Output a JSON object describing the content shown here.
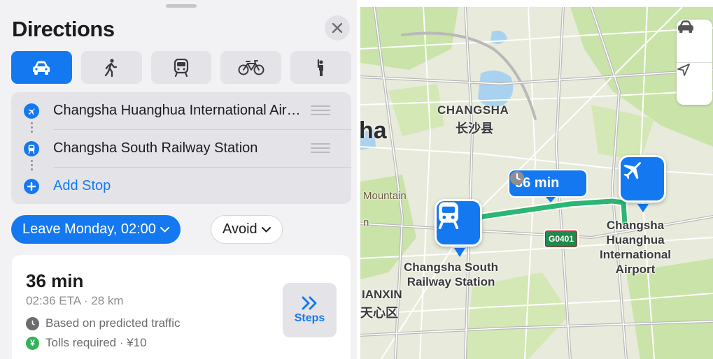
{
  "panel": {
    "title": "Directions",
    "close_icon": "close-icon",
    "transport_modes": [
      {
        "id": "drive",
        "icon": "car-icon",
        "active": true
      },
      {
        "id": "walk",
        "icon": "walking-person-icon",
        "active": false
      },
      {
        "id": "transit",
        "icon": "train-icon",
        "active": false
      },
      {
        "id": "cycle",
        "icon": "bicycle-icon",
        "active": false
      },
      {
        "id": "ride",
        "icon": "hailing-person-icon",
        "active": false
      }
    ],
    "stops": [
      {
        "label": "Changsha Huanghua International Airport",
        "icon": "airplane-icon"
      },
      {
        "label": "Changsha South Railway Station",
        "icon": "train-icon"
      }
    ],
    "add_stop_label": "Add Stop",
    "leave_label": "Leave Monday, 02:00",
    "avoid_label": "Avoid",
    "route": {
      "duration": "36 min",
      "eta_distance": "02:36 ETA · 28 km",
      "traffic_note": "Based on predicted traffic",
      "tolls_note": "Tolls required · ¥10",
      "steps_label": "Steps"
    }
  },
  "map": {
    "callout_duration": "36 min",
    "city_label_en": "CHANGSHA",
    "city_label_zh": "长沙县",
    "partial_label_left": "ha",
    "mountain_label": "Mountain",
    "district_label_en": "IANXIN",
    "district_label_zh": "天心区",
    "partial_label_small": "n",
    "highway_shield": "G0401",
    "origin_label": "Changsha\nHuanghua\nInternational\nAirport",
    "destination_label": "Changsha South\nRailway Station",
    "colors": {
      "route": "#2bb673",
      "accent": "#1479f0",
      "park": "#c9e3a9",
      "water": "#a9d2f0"
    }
  }
}
